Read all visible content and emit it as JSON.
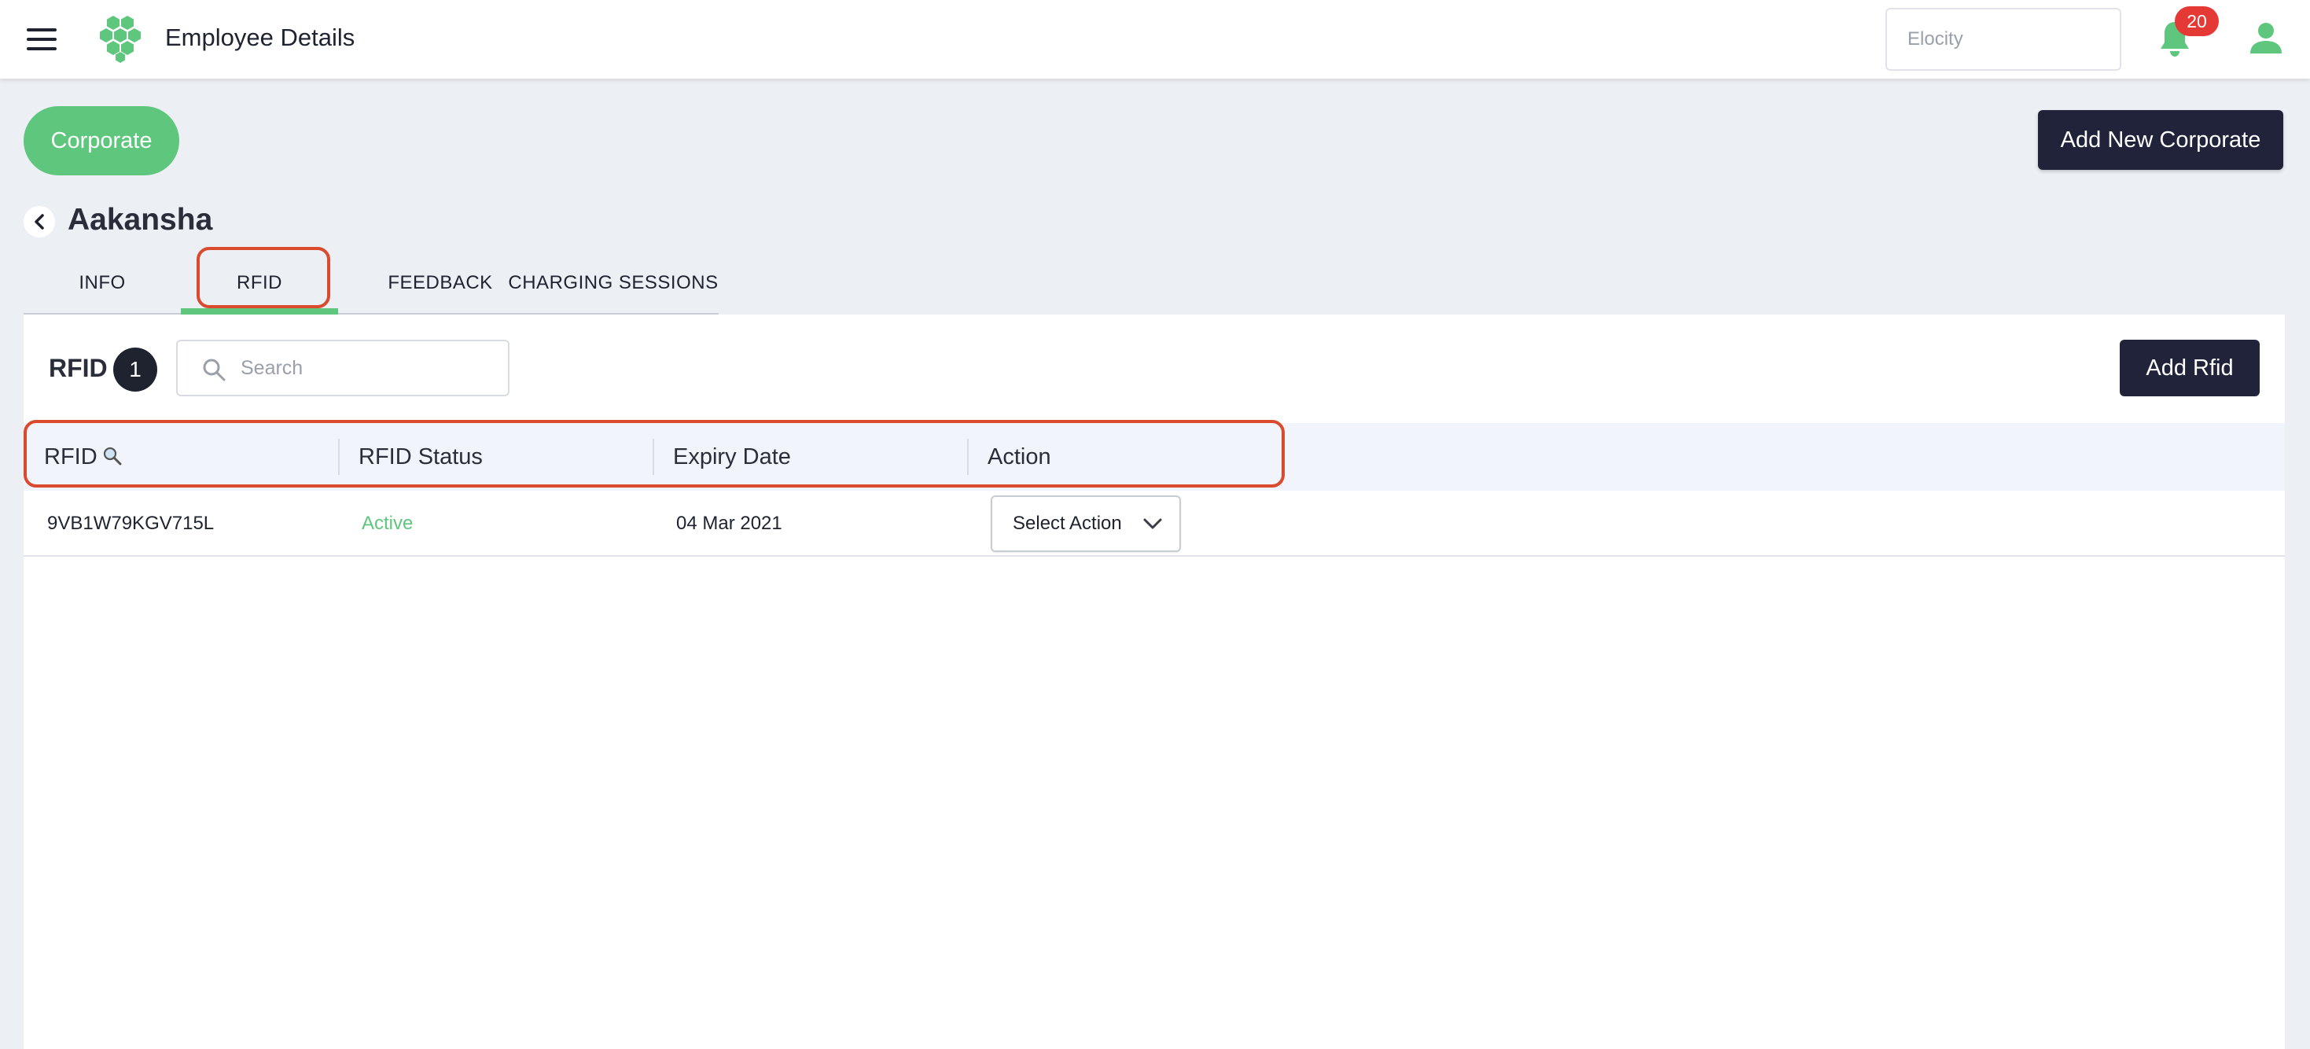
{
  "header": {
    "title": "Employee Details",
    "location_placeholder": "Elocity",
    "notification_count": "20"
  },
  "actions": {
    "corporate_label": "Corporate",
    "add_corporate_label": "Add New Corporate"
  },
  "employee": {
    "name": "Aakansha"
  },
  "tabs": [
    {
      "label": "INFO"
    },
    {
      "label": "RFID",
      "active": true
    },
    {
      "label": "FEEDBACK"
    },
    {
      "label": "CHARGING SESSIONS"
    }
  ],
  "rfid_section": {
    "title": "RFID",
    "count": "1",
    "search_placeholder": "Search",
    "add_label": "Add Rfid",
    "columns": [
      "RFID",
      "RFID Status",
      "Expiry Date",
      "Action"
    ],
    "rows": [
      {
        "rfid": "9VB1W79KGV715L",
        "status": "Active",
        "expiry": "04 Mar 2021",
        "action": "Select Action"
      }
    ]
  },
  "colors": {
    "accent_green": "#5fc67e",
    "dark_button": "#20233a",
    "highlight_red": "#d94a2e",
    "badge_red": "#e53935"
  }
}
